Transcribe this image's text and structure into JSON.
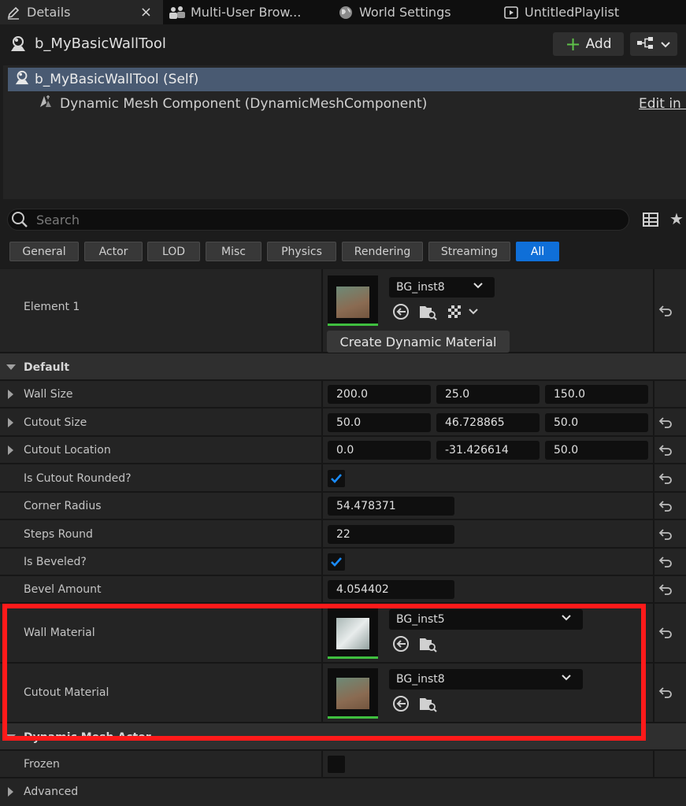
{
  "tabs": [
    {
      "label": "Details",
      "icon": "pencil-icon"
    },
    {
      "label": "Multi-User Brow...",
      "icon": "users-icon"
    },
    {
      "label": "World Settings",
      "icon": "globe-icon"
    },
    {
      "label": "UntitledPlaylist",
      "icon": "playlist-icon"
    }
  ],
  "tab_close": "×",
  "header": {
    "title": "b_MyBasicWallTool",
    "add_label": "Add"
  },
  "tree": {
    "self": "b_MyBasicWallTool (Self)",
    "component": "Dynamic Mesh Component (DynamicMeshComponent)",
    "edit_link": "Edit in C"
  },
  "search": {
    "placeholder": "Search"
  },
  "filters": [
    "General",
    "Actor",
    "LOD",
    "Misc",
    "Physics",
    "Rendering",
    "Streaming",
    "All"
  ],
  "active_filter": "All",
  "element1": {
    "label": "Element 1",
    "material": "BG_inst8",
    "create_button": "Create Dynamic Material"
  },
  "default_section": {
    "label": "Default",
    "wall_size": {
      "label": "Wall Size",
      "x": "200.0",
      "y": "25.0",
      "z": "150.0"
    },
    "cutout_size": {
      "label": "Cutout Size",
      "x": "50.0",
      "y": "46.728865",
      "z": "50.0"
    },
    "cutout_location": {
      "label": "Cutout Location",
      "x": "0.0",
      "y": "-31.426614",
      "z": "50.0"
    },
    "is_cutout_rounded": {
      "label": "Is Cutout Rounded?",
      "checked": true
    },
    "corner_radius": {
      "label": "Corner Radius",
      "value": "54.478371"
    },
    "steps_round": {
      "label": "Steps Round",
      "value": "22"
    },
    "is_beveled": {
      "label": "Is Beveled?",
      "checked": true
    },
    "bevel_amount": {
      "label": "Bevel Amount",
      "value": "4.054402"
    },
    "wall_material": {
      "label": "Wall Material",
      "value": "BG_inst5"
    },
    "cutout_material": {
      "label": "Cutout Material",
      "value": "BG_inst8"
    }
  },
  "dynamic_mesh_actor": {
    "label": "Dynamic Mesh Actor"
  },
  "frozen": {
    "label": "Frozen",
    "checked": false
  },
  "advanced": {
    "label": "Advanced"
  },
  "colors": {
    "accent": "#0f6fd8",
    "highlight_box": "#ff1a1a",
    "selection": "#495a72",
    "thumbnail_bar": "#3fbf3f"
  }
}
